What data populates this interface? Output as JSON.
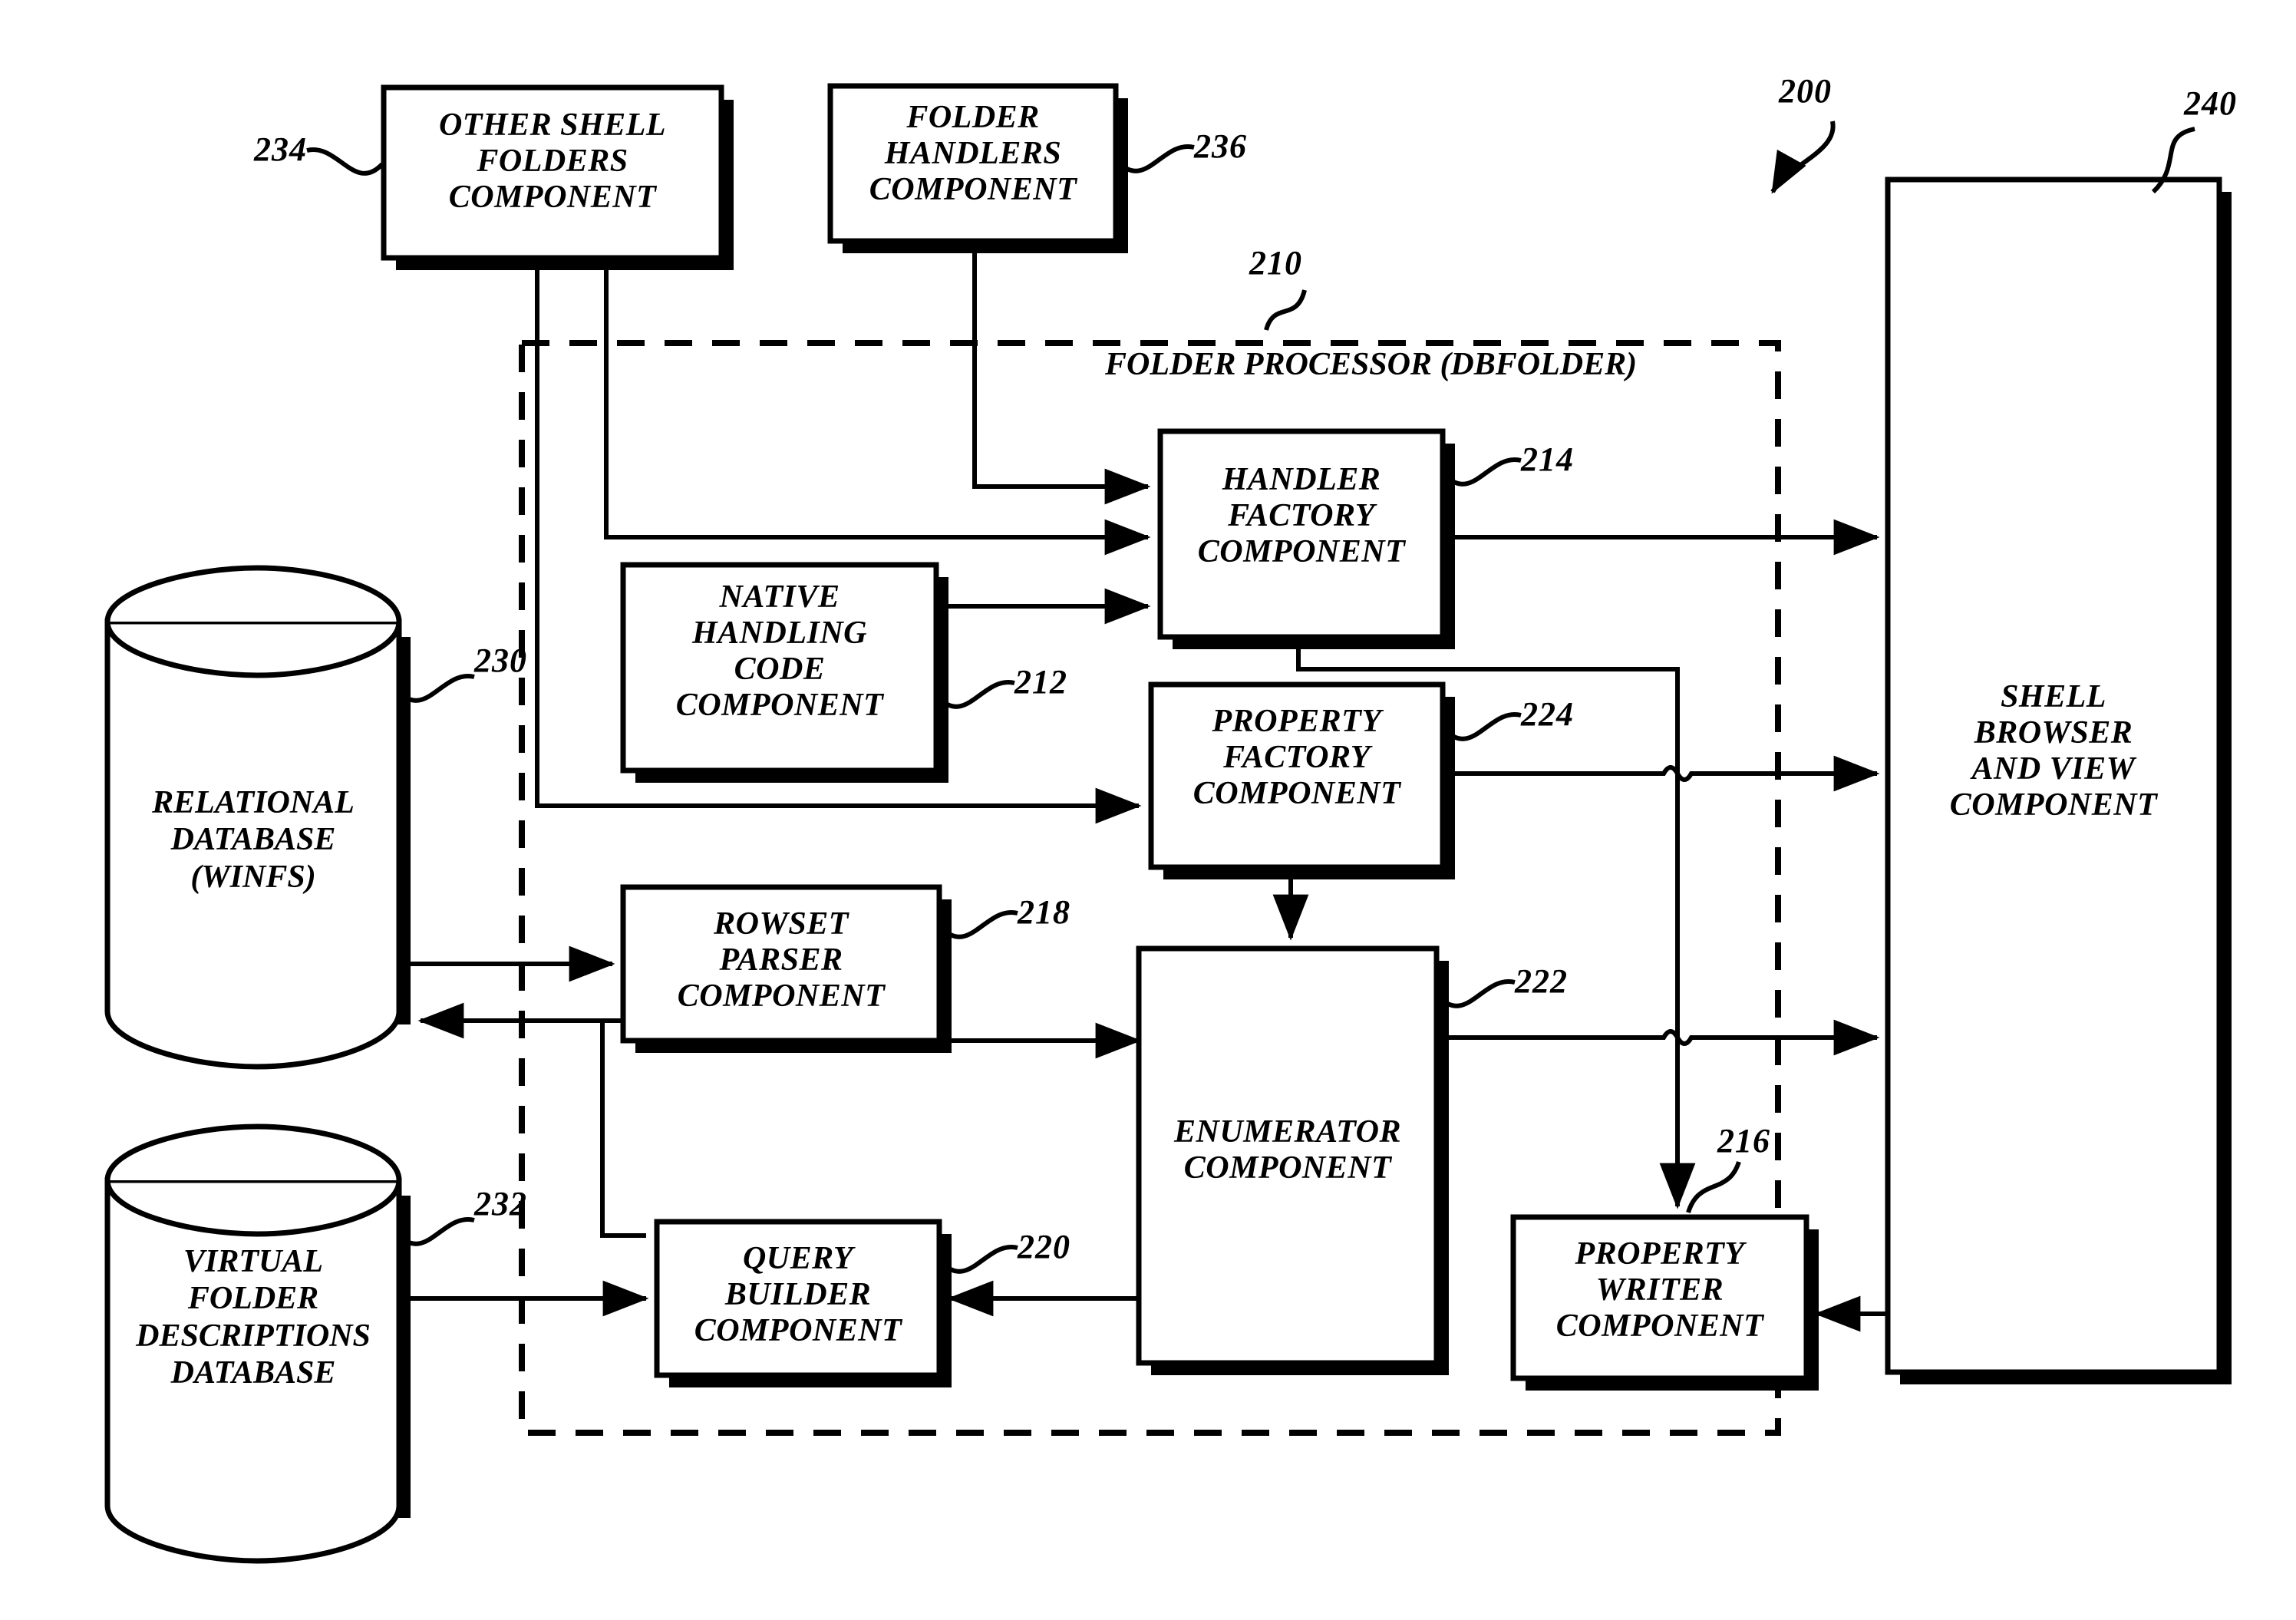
{
  "figure": {
    "title": "Folder Processor (DBFolder) architecture block diagram",
    "overall_ref": "200",
    "region": {
      "label": "FOLDER PROCESSOR (DBFOLDER)",
      "ref": "210"
    }
  },
  "boxes": {
    "other_shell_folders": {
      "label": "OTHER SHELL\nFOLDERS\nCOMPONENT",
      "ref": "234"
    },
    "folder_handlers": {
      "label": "FOLDER\nHANDLERS\nCOMPONENT",
      "ref": "236"
    },
    "handler_factory": {
      "label": "HANDLER\nFACTORY\nCOMPONENT",
      "ref": "214"
    },
    "native_handling_code": {
      "label": "NATIVE\nHANDLING\nCODE\nCOMPONENT",
      "ref": "212"
    },
    "property_factory": {
      "label": "PROPERTY\nFACTORY\nCOMPONENT",
      "ref": "224"
    },
    "rowset_parser": {
      "label": "ROWSET\nPARSER\nCOMPONENT",
      "ref": "218"
    },
    "enumerator": {
      "label": "ENUMERATOR\nCOMPONENT",
      "ref": "222"
    },
    "query_builder": {
      "label": "QUERY\nBUILDER\nCOMPONENT",
      "ref": "220"
    },
    "property_writer": {
      "label": "PROPERTY\nWRITER\nCOMPONENT",
      "ref": "216"
    },
    "shell_browser": {
      "label": "SHELL\nBROWSER\nAND VIEW\nCOMPONENT",
      "ref": "240"
    }
  },
  "cylinders": {
    "relational_database": {
      "label": "RELATIONAL\nDATABASE\n(WINFS)",
      "ref": "230"
    },
    "virtual_folder_descriptions": {
      "label": "VIRTUAL\nFOLDER\nDESCRIPTIONS\nDATABASE",
      "ref": "232"
    }
  },
  "style": {
    "stroke": "#000000",
    "background": "#ffffff"
  }
}
